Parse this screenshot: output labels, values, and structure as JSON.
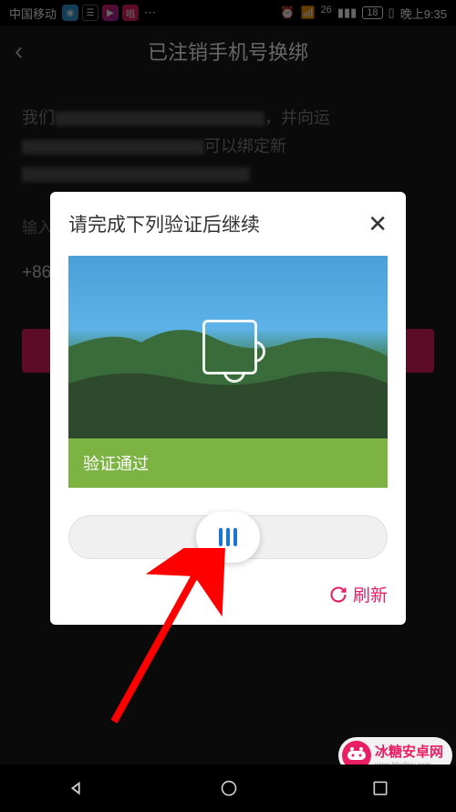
{
  "status_bar": {
    "carrier": "中国移动",
    "network": "26",
    "battery": "18",
    "time": "晚上9:35"
  },
  "header": {
    "title": "已注销手机号换绑"
  },
  "content": {
    "desc_start": "我们",
    "desc_mid1": "，并向运",
    "desc_mid2": "可以绑定新",
    "input_label": "输入",
    "phone_prefix": "+86"
  },
  "modal": {
    "title": "请完成下列验证后继续",
    "success_text": "验证通过",
    "refresh_label": "刷新"
  },
  "watermark": {
    "text": "冰糖安卓网",
    "url": "www.btxdmy.com"
  }
}
